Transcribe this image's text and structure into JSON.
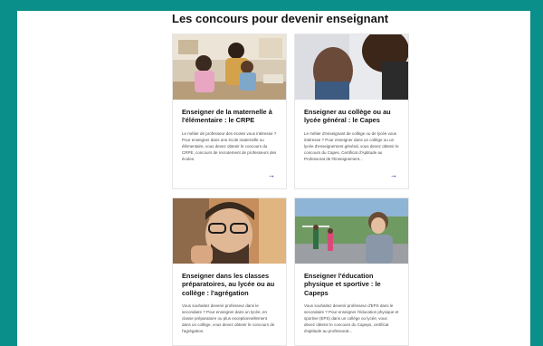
{
  "section": {
    "title": "Les concours pour devenir enseignant"
  },
  "cards": [
    {
      "title": "Enseigner de la maternelle à l'élémentaire : le CRPE",
      "description": "Le métier de professeur des écoles vous intéresse ? Pour enseigner dans une école maternelle ou élémentaire, vous devez obtenir le concours du CRPE, concours de recrutement de professeurs des écoles.",
      "arrow_icon": "arrow-right-icon"
    },
    {
      "title": "Enseigner au collège ou au lycée général : le Capes",
      "description": "Le métier d'enseignant de collège ou de lycée vous intéresse ? Pour enseigner dans un collège ou un lycée d'enseignement général, vous devez obtenir le concours du Capes, Certificat d'Aptitude au Professorat de l'Enseignement...",
      "arrow_icon": "arrow-right-icon"
    },
    {
      "title": "Enseigner dans les classes préparatoires, au lycée ou au collège : l'agrégation",
      "description": "Vous souhaitez devenir professeur dans le secondaire ? Pour enseigner dans un lycée, en classe préparatoire ou plus exceptionnellement dans un collège, vous devez obtenir le concours de l'agrégation.",
      "arrow_icon": "arrow-right-icon"
    },
    {
      "title": "Enseigner l'éducation physique et sportive : le Capeps",
      "description": "Vous souhaitez devenir professeur d'EPS dans le secondaire ? Pour enseigner l'éducation physique et sportive (EPS) dans un collège ou lycée, vous devez obtenir le concours du Capeps, certificat d'aptitude au professorat...",
      "arrow_icon": "arrow-right-icon"
    }
  ],
  "colors": {
    "frame": "#0a8f8b",
    "accent": "#000091",
    "text": "#161616"
  }
}
